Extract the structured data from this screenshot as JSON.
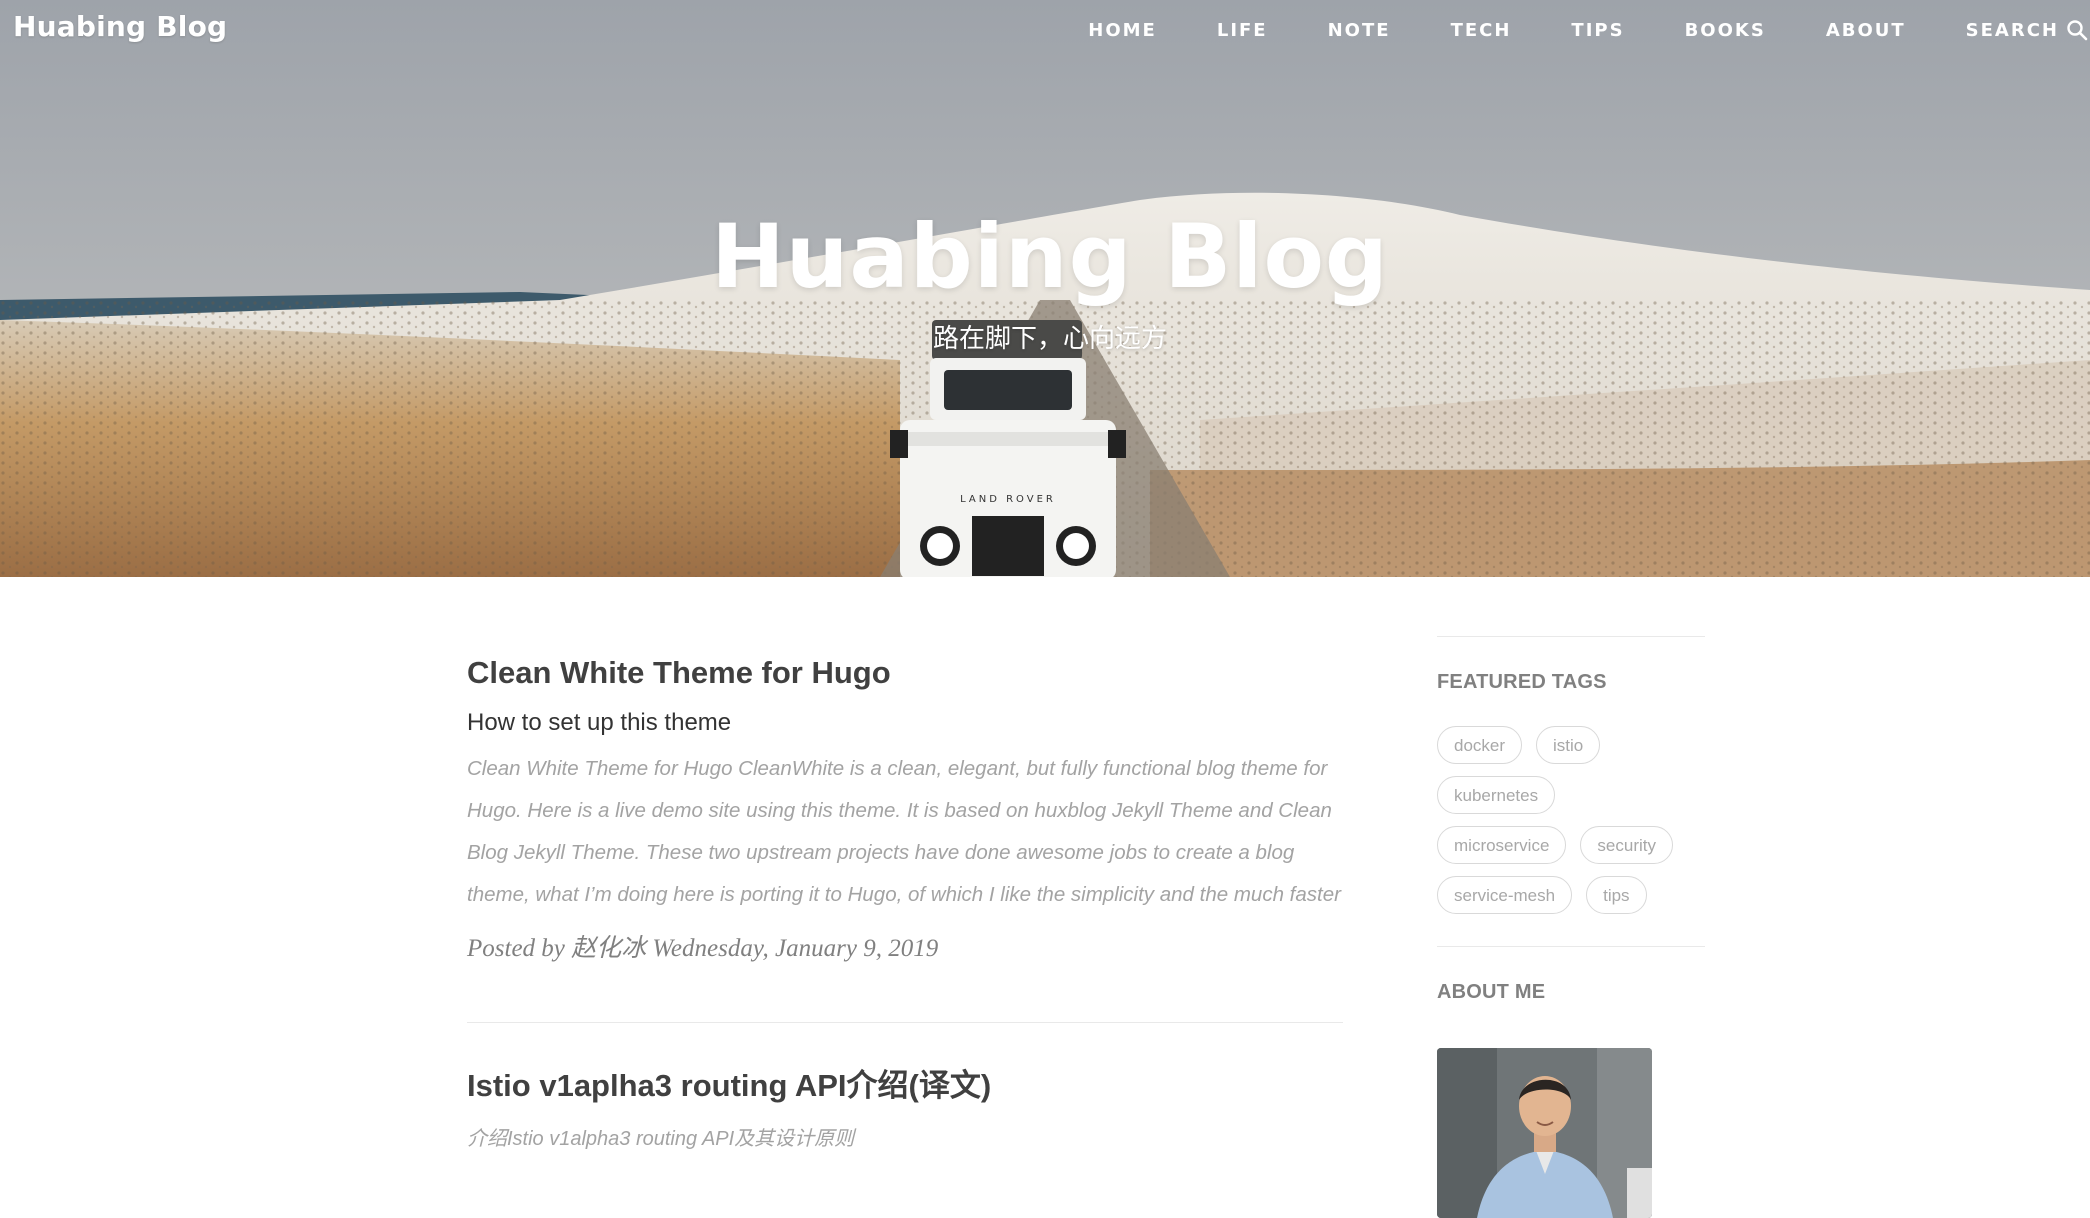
{
  "site": {
    "brand": "Huabing Blog",
    "hero_title": "Huabing Blog",
    "hero_subtitle": "路在脚下，心向远方"
  },
  "nav": {
    "items": [
      "HOME",
      "LIFE",
      "NOTE",
      "TECH",
      "TIPS",
      "BOOKS",
      "ABOUT"
    ],
    "search_label": "SEARCH",
    "search_icon": "search-icon"
  },
  "hero_image": {
    "subject": "white Land Rover on a snowy plateau road",
    "vehicle_badge": "LAND ROVER"
  },
  "posts": [
    {
      "title": "Clean White Theme for Hugo",
      "subtitle": "How to set up this theme",
      "excerpt": "Clean White Theme for Hugo CleanWhite is a clean, elegant, but fully functional blog theme for Hugo. Here is a live demo site using this theme. It is based on huxblog Jekyll Theme and Clean Blog Jekyll Theme. These two upstream projects have done awesome jobs to create a blog theme, what I’m doing here is porting it to Hugo, of which I like the simplicity and the much faster",
      "meta": "Posted by 赵化冰 Wednesday, January 9, 2019"
    },
    {
      "title": "Istio v1aplha3 routing API介绍(译文)",
      "subtitle": "介绍Istio v1alpha3 routing API及其设计原则"
    }
  ],
  "sidebar": {
    "featured_tags_heading": "FEATURED TAGS",
    "tags": [
      "docker",
      "istio",
      "kubernetes",
      "microservice",
      "security",
      "service-mesh",
      "tips"
    ],
    "about_heading": "ABOUT ME"
  },
  "colors": {
    "text": "#404040",
    "muted": "#a3a3a3",
    "tag_border": "#d9d9d9",
    "hero_overlay_text": "#ffffff"
  }
}
